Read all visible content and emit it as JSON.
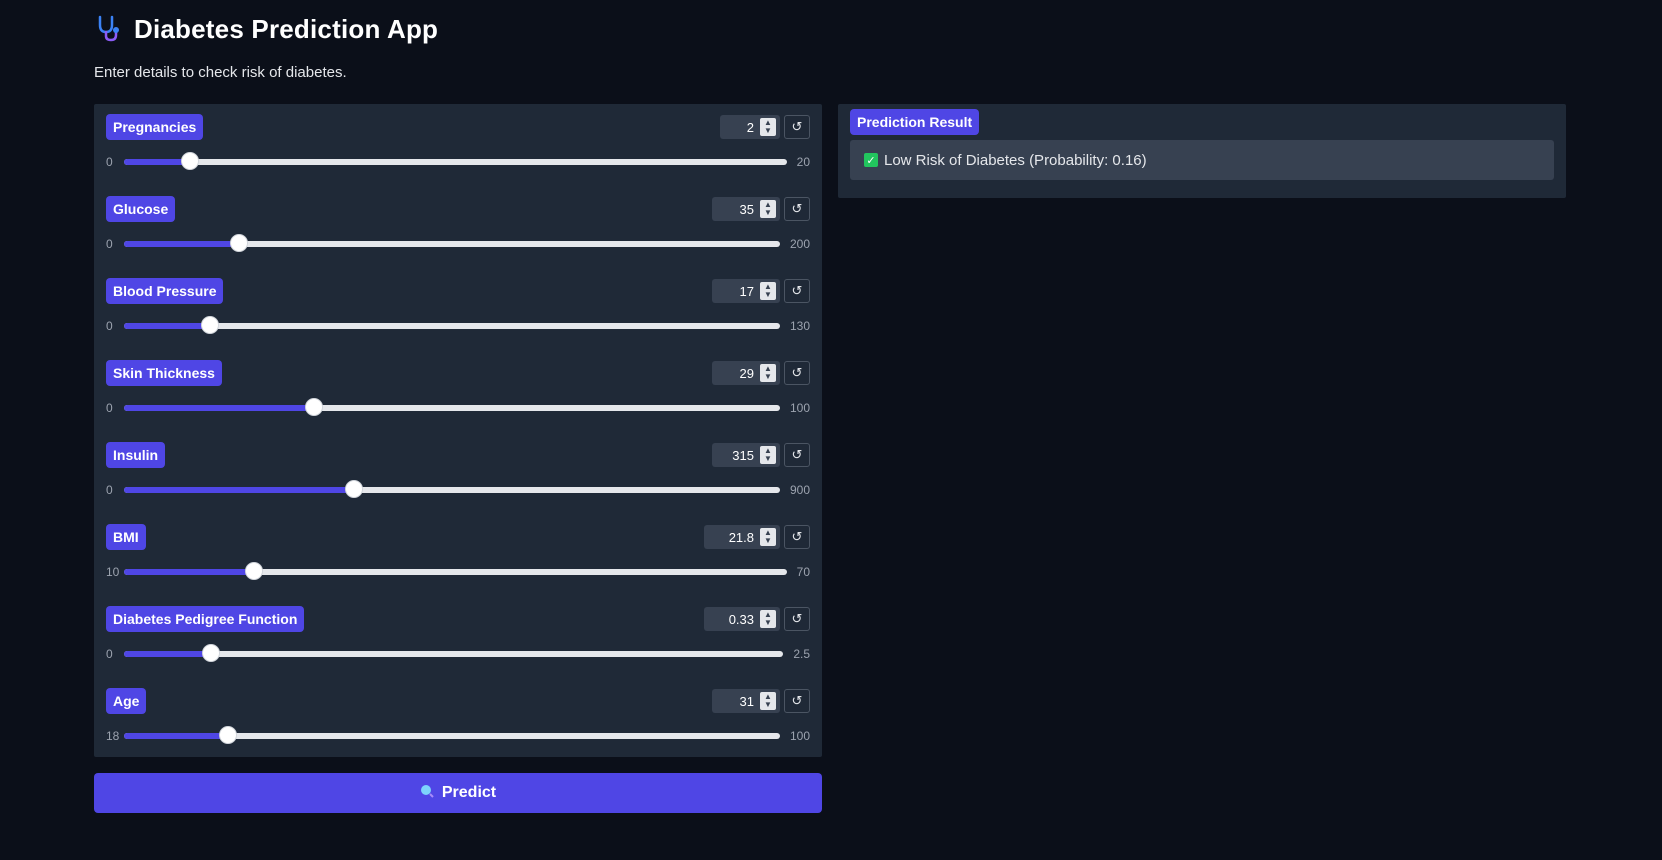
{
  "header": {
    "title": "Diabetes Prediction App",
    "subtitle": "Enter details to check risk of diabetes.",
    "logo_icon": "stethoscope-icon"
  },
  "colors": {
    "background": "#0b0f19",
    "panel": "#1f2937",
    "accent": "#4f46e5",
    "track": "#e5e7eb"
  },
  "inputs": [
    {
      "label": "Pregnancies",
      "value": "2",
      "min": "0",
      "max": "20",
      "num_value": 2,
      "num_min": 0,
      "num_max": 20
    },
    {
      "label": "Glucose",
      "value": "35",
      "min": "0",
      "max": "200",
      "num_value": 35,
      "num_min": 0,
      "num_max": 200
    },
    {
      "label": "Blood Pressure",
      "value": "17",
      "min": "0",
      "max": "130",
      "num_value": 17,
      "num_min": 0,
      "num_max": 130
    },
    {
      "label": "Skin Thickness",
      "value": "29",
      "min": "0",
      "max": "100",
      "num_value": 29,
      "num_min": 0,
      "num_max": 100
    },
    {
      "label": "Insulin",
      "value": "315",
      "min": "0",
      "max": "900",
      "num_value": 315,
      "num_min": 0,
      "num_max": 900
    },
    {
      "label": "BMI",
      "value": "21.8",
      "min": "10",
      "max": "70",
      "num_value": 21.8,
      "num_min": 10,
      "num_max": 70
    },
    {
      "label": "Diabetes Pedigree Function",
      "value": "0.33",
      "min": "0",
      "max": "2.5",
      "num_value": 0.33,
      "num_min": 0,
      "num_max": 2.5
    },
    {
      "label": "Age",
      "value": "31",
      "min": "18",
      "max": "100",
      "num_value": 31,
      "num_min": 18,
      "num_max": 100
    }
  ],
  "reset_symbol": "↺",
  "predict_button": {
    "label": "Predict",
    "icon": "search-icon"
  },
  "result": {
    "label": "Prediction Result",
    "text": "Low Risk of Diabetes (Probability: 0.16)",
    "icon": "check-box-icon"
  }
}
